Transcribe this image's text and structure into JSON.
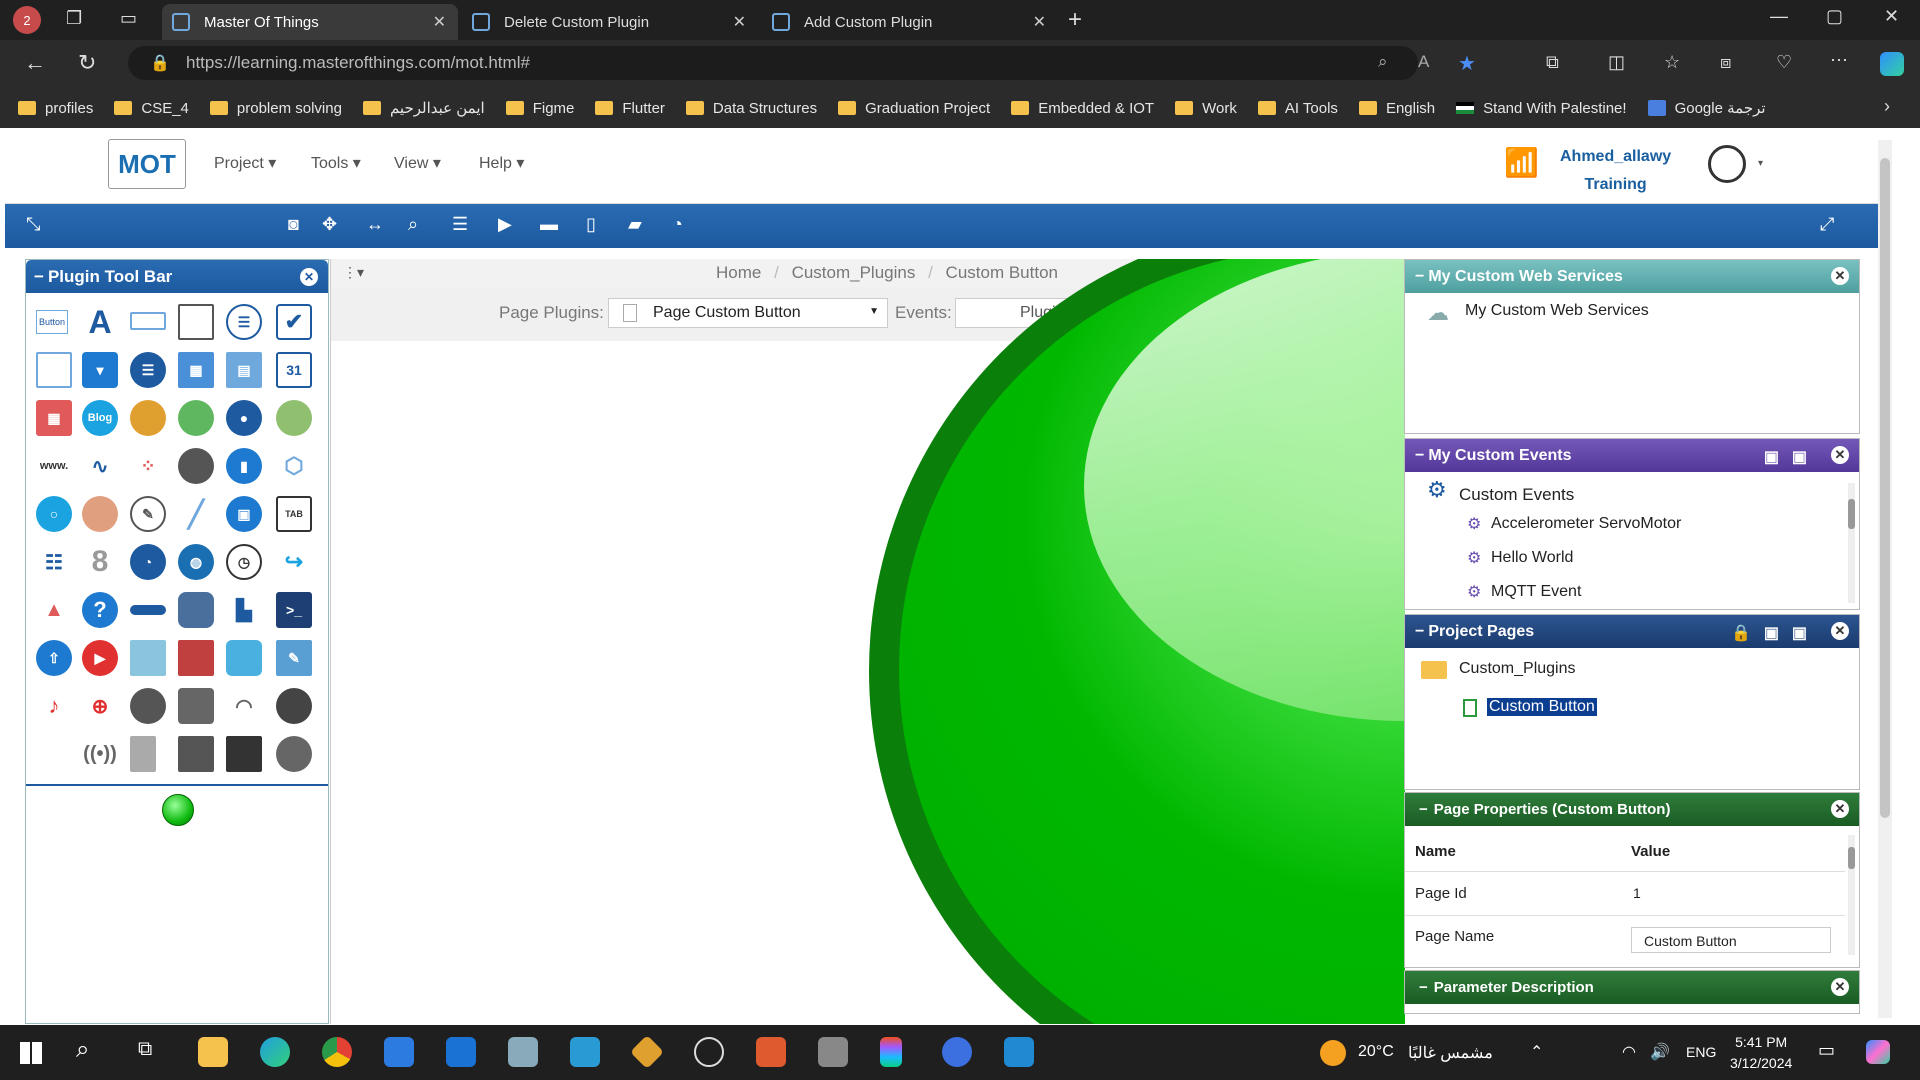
{
  "browser": {
    "profile_badge": "2",
    "tabs": [
      {
        "title": "Master Of Things",
        "active": true
      },
      {
        "title": "Delete Custom Plugin",
        "active": false
      },
      {
        "title": "Add Custom Plugin",
        "active": false
      }
    ],
    "url": "https://learning.masterofthings.com/mot.html#",
    "bookmarks": [
      "profiles",
      "CSE_4",
      "problem solving",
      "ايمن عبدالرحيم",
      "Figme",
      "Flutter",
      "Data Structures",
      "Graduation Project",
      "Embedded & IOT",
      "Work",
      "AI Tools",
      "English",
      "Stand With Palestine!",
      "Google ترجمة"
    ]
  },
  "header": {
    "logo_text": "MOT",
    "menus": [
      "Project",
      "Tools",
      "View",
      "Help"
    ],
    "user_name": "Ahmed_allawy",
    "user_role": "Training"
  },
  "plugin_toolbar": {
    "title": "Plugin Tool Bar",
    "button_label": "Button"
  },
  "center": {
    "breadcrumb": [
      "Home",
      "Custom_Plugins",
      "Custom Button"
    ],
    "page_plugins_label": "Page Plugins:",
    "page_plugins_value": "Page Custom Button",
    "events_label": "Events:",
    "events_value": "Plugin/P"
  },
  "panels": {
    "web_services": {
      "title": "My Custom Web Services",
      "item": "My Custom Web Services"
    },
    "events": {
      "title": "My Custom Events",
      "root": "Custom Events",
      "items": [
        "Accelerometer ServoMotor",
        "Hello World",
        "MQTT Event"
      ]
    },
    "pages": {
      "title": "Project Pages",
      "folder": "Custom_Plugins",
      "page": "Custom Button"
    },
    "properties": {
      "title": "Page Properties (Custom Button)",
      "col_name": "Name",
      "col_value": "Value",
      "rows": [
        {
          "name": "Page Id",
          "value": "1"
        },
        {
          "name": "Page Name",
          "value": "Custom Button"
        }
      ]
    },
    "params": {
      "title": "Parameter Description"
    }
  },
  "taskbar": {
    "weather": "20°C",
    "weather_text": "مشمس غالبًا",
    "lang": "ENG",
    "time": "5:41 PM",
    "date": "3/12/2024"
  },
  "colors": {
    "blue": "#1d5aa0",
    "teal": "#5aa8a8",
    "purple": "#5b3f9e",
    "navy": "#1c3f73",
    "green": "#1f6b2a",
    "sphere": "#00b800"
  }
}
